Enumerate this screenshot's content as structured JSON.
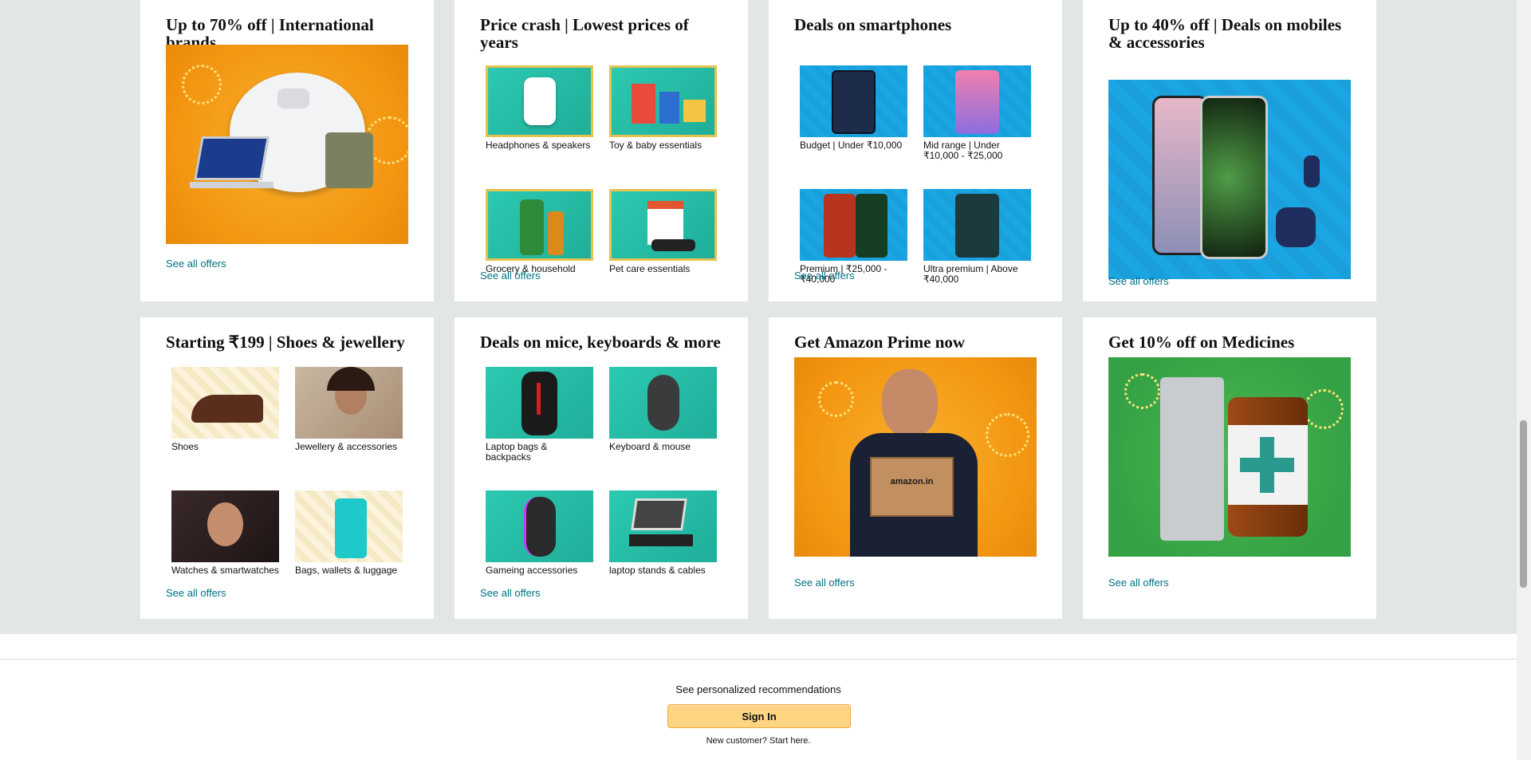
{
  "cards": [
    {
      "title": "Up to 70% off | International brands",
      "link": "See all offers"
    },
    {
      "title": "Price crash | Lowest prices of years",
      "link": "See all offers",
      "tiles": [
        "Headphones & speakers",
        "Toy & baby essentials",
        "Grocery & household",
        "Pet care essentials"
      ]
    },
    {
      "title": "Deals on smartphones",
      "link": "See all offers",
      "tiles": [
        "Budget | Under ₹10,000",
        "Mid range | Under ₹10,000 - ₹25,000",
        "Premium | ₹25,000 - ₹40,000",
        "Ultra premium | Above ₹40,000"
      ]
    },
    {
      "title": "Up to 40% off | Deals on mobiles & accessories",
      "link": "See all offers"
    },
    {
      "title": "Starting ₹199 | Shoes & jewellery",
      "link": "See all offers",
      "tiles": [
        "Shoes",
        "Jewellery & accessories",
        "Watches & smartwatches",
        "Bags, wallets & luggage"
      ]
    },
    {
      "title": "Deals on mice, keyboards & more",
      "link": "See all offers",
      "tiles": [
        "Laptop bags & backpacks",
        "Keyboard & mouse",
        "Gameing accessories",
        "laptop stands & cables"
      ]
    },
    {
      "title": "Get Amazon Prime now",
      "link": "See all offers",
      "box_text": "amazon.in"
    },
    {
      "title": "Get 10% off on Medicines",
      "link": "See all offers"
    }
  ],
  "footer": {
    "recommendations": "See personalized recommendations",
    "signin_label": "Sign In",
    "new_customer": "New customer? Start here."
  },
  "colors": {
    "link": "#007185",
    "signin_bg": "#ffd583",
    "page_bg": "#e3e6e6"
  }
}
